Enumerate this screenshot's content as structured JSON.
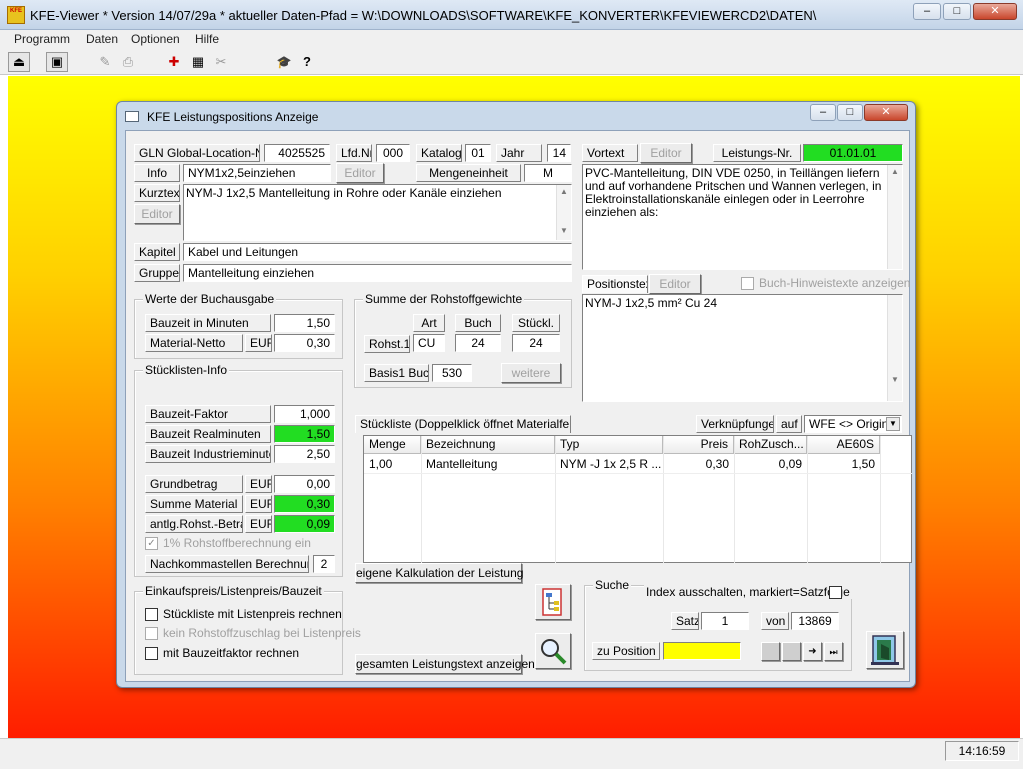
{
  "app": {
    "title": "KFE-Viewer * Version 14/07/29a * aktueller Daten-Pfad = W:\\DOWNLOADS\\SOFTWARE\\KFE_KONVERTER\\KFEVIEWERCD2\\DATEN\\",
    "logo_text": "KFE",
    "window_buttons": {
      "minimize": "–",
      "maximize": "□",
      "close": "✕"
    }
  },
  "menu": [
    "Programm",
    "Daten",
    "Optionen",
    "Hilfe"
  ],
  "toolbar_icons": [
    "exit-icon",
    "screen-icon",
    "edit-icon",
    "print-icon",
    "add-icon",
    "grid-icon",
    "tools-icon",
    "graduation-cap-icon",
    "help-icon"
  ],
  "toolbar_glyphs": [
    "⏏",
    "▣",
    "✎",
    "⎙",
    "✚",
    "▦",
    "✂",
    "🎓",
    "?"
  ],
  "status": {
    "time": "14:16:59"
  },
  "dialog": {
    "title": "KFE Leistungspositions Anzeige",
    "buttons": {
      "minimize": "–",
      "maximize": "□",
      "close": "✕"
    },
    "header": {
      "gln_label": "GLN Global-Location-Nr.",
      "gln_value": "4025525",
      "lfd_label": "Lfd.Nr.",
      "lfd_value": "000",
      "katalog_label": "Katalog",
      "katalog_value": "01",
      "jahr_label": "Jahr",
      "jahr_value": "14",
      "info_label": "Info",
      "info_value": "NYM1x2,5einziehen",
      "editor_label": "Editor",
      "mengeneinheit_label": "Mengeneinheit",
      "mengeneinheit_value": "M",
      "kurztext_label": "Kurztext",
      "kurztext_value": "NYM-J 1x2,5 Mantelleitung in Rohre oder Kanäle einziehen",
      "kapitel_label": "Kapitel",
      "kapitel_value": "Kabel und Leitungen",
      "gruppe_label": "Gruppe",
      "gruppe_value": "Mantelleitung einziehen"
    },
    "vortext": {
      "label": "Vortext",
      "editor_label": "Editor",
      "leistungs_label": "Leistungs-Nr.",
      "leistungs_value": "01.01.01",
      "text": "PVC-Mantelleitung, DIN VDE 0250, in Teillängen liefern und auf vorhandene Pritschen und Wannen verlegen, in Elektroinstallationskanäle einlegen oder in Leerrohre einziehen als:"
    },
    "positionstext": {
      "label": "Positionstext",
      "editor_label": "Editor",
      "buch_hinweis_label": "Buch-Hinweistexte anzeigen",
      "text": "NYM-J 1x2,5 mm² Cu 24"
    },
    "buchausgabe": {
      "title": "Werte der Buchausgabe",
      "bauzeit_label": "Bauzeit in Minuten",
      "bauzeit_value": "1,50",
      "material_label": "Material-Netto",
      "material_currency": "EUR",
      "material_value": "0,30"
    },
    "rohstoff": {
      "title": "Summe der Rohstoffgewichte",
      "col_art": "Art",
      "col_buch": "Buch",
      "col_stueckl": "Stückl.",
      "row_label": "Rohst.1",
      "row_art": "CU",
      "row_buch": "24",
      "row_stueckl": "24",
      "basis_label": "Basis1 Buch",
      "basis_value": "530",
      "weitere_label": "weitere"
    },
    "stueckliste_info": {
      "title": "Stücklisten-Info",
      "faktor_label": "Bauzeit-Faktor",
      "faktor_value": "1,000",
      "real_label": "Bauzeit Realminuten",
      "real_value": "1,50",
      "industrie_label": "Bauzeit Industrieminuten",
      "industrie_value": "2,50",
      "grundbetrag_label": "Grundbetrag",
      "grundbetrag_currency": "EUR",
      "grundbetrag_value": "0,00",
      "summe_label": "Summe Material",
      "summe_currency": "EUR",
      "summe_value": "0,30",
      "antl_label": "antlg.Rohst.-Betrag",
      "antl_currency": "EUR",
      "antl_value": "0,09",
      "rohstoff_chk_label": "1% Rohstoffberechnung ein",
      "nachkomma_label": "Nachkommastellen Berechnung",
      "nachkomma_value": "2"
    },
    "einkauf": {
      "title": "Einkaufspreis/Listenpreis/Bauzeit",
      "opt1": "Stückliste mit Listenpreis rechnen",
      "opt2": "kein Rohstoffzuschlag bei Listenpreis",
      "opt3": "mit Bauzeitfaktor rechnen"
    },
    "stueckliste": {
      "label": "Stückliste (Doppelklick öffnet Materialfenster)",
      "verkn_label": "Verknüpfungen",
      "auf_label": "auf",
      "select_value": "WFE  <> Origina",
      "columns": [
        "Menge",
        "Bezeichnung",
        "Typ",
        "Preis",
        "RohZusch...",
        "AE60S"
      ],
      "rows": [
        [
          "1,00",
          "Mantelleitung",
          "NYM -J  1x 2,5 R  ...",
          "0,30",
          "0,09",
          "1,50"
        ]
      ]
    },
    "kalkulation_label": "eigene Kalkulation der Leistung",
    "gesamt_label": "gesamten Leistungstext anzeigen",
    "suche": {
      "title": "Suche",
      "index_label": "Index ausschalten, markiert=Satzfolge",
      "satz_label": "Satz",
      "satz_value": "1",
      "von_label": "von",
      "von_value": "13869",
      "zu_label": "zu Position",
      "zu_value": ""
    },
    "colors": {
      "green": "#22dd22",
      "yellow": "#ffff00"
    }
  }
}
